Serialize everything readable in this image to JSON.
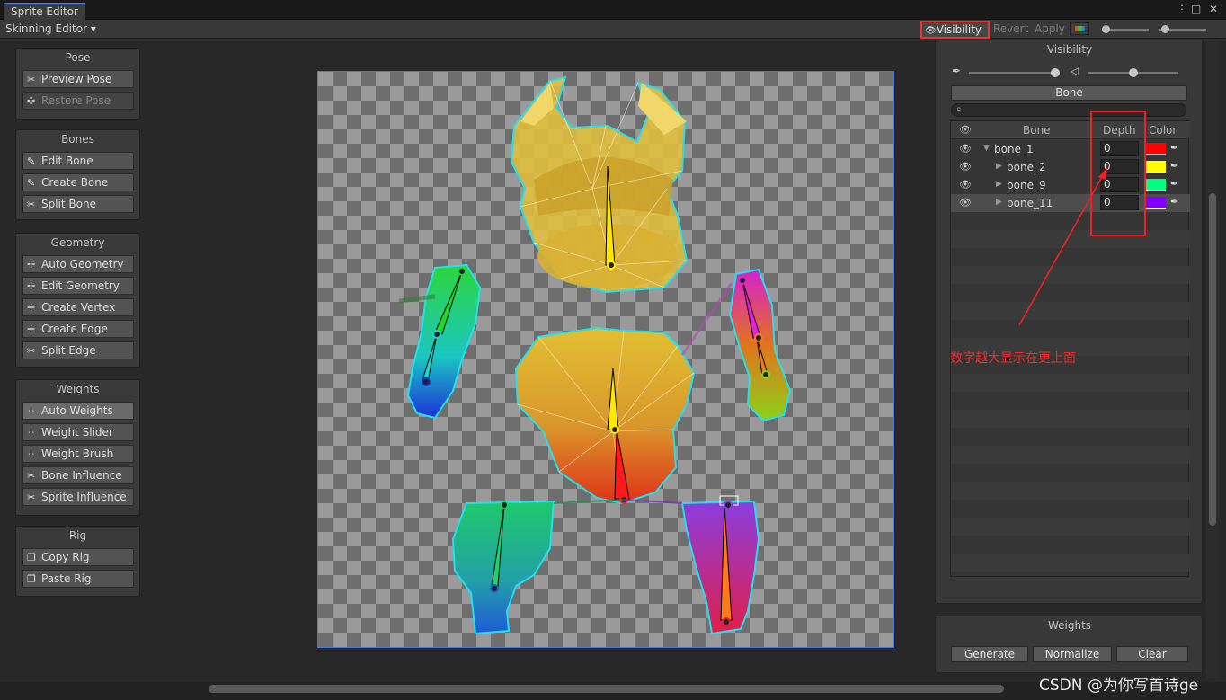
{
  "window": {
    "tab_title": "Sprite Editor",
    "menu_icon": "⋮",
    "maximize_icon": "□",
    "close_icon": "✕"
  },
  "toolbar": {
    "mode_label": "Skinning Editor",
    "mode_caret": "▾",
    "visibility_label": "Visibility",
    "revert_label": "Revert",
    "apply_label": "Apply"
  },
  "tool_panels": {
    "pose": {
      "title": "Pose",
      "items": [
        {
          "label": "Preview Pose",
          "icon": "✂"
        },
        {
          "label": "Restore Pose",
          "icon": "✣"
        }
      ]
    },
    "bones": {
      "title": "Bones",
      "items": [
        {
          "label": "Edit Bone",
          "icon": "✎"
        },
        {
          "label": "Create Bone",
          "icon": "✎"
        },
        {
          "label": "Split Bone",
          "icon": "✂"
        }
      ]
    },
    "geometry": {
      "title": "Geometry",
      "items": [
        {
          "label": "Auto Geometry",
          "icon": "✢"
        },
        {
          "label": "Edit Geometry",
          "icon": "✢"
        },
        {
          "label": "Create Vertex",
          "icon": "✛"
        },
        {
          "label": "Create Edge",
          "icon": "✛"
        },
        {
          "label": "Split Edge",
          "icon": "✂"
        }
      ]
    },
    "weights": {
      "title": "Weights",
      "items": [
        {
          "label": "Auto Weights",
          "icon": "⁘"
        },
        {
          "label": "Weight Slider",
          "icon": "⁘"
        },
        {
          "label": "Weight Brush",
          "icon": "⁘"
        },
        {
          "label": "Bone Influence",
          "icon": "✂"
        },
        {
          "label": "Sprite Influence",
          "icon": "✂"
        }
      ]
    },
    "rig": {
      "title": "Rig",
      "items": [
        {
          "label": "Copy Rig",
          "icon": "❐"
        },
        {
          "label": "Paste Rig",
          "icon": "❐"
        }
      ]
    }
  },
  "visibility_panel": {
    "title": "Visibility",
    "bone_tab_label": "Bone",
    "search_icon": "⌕",
    "columns": {
      "bone": "Bone",
      "depth": "Depth",
      "color": "Color"
    },
    "eye_icon": "👁",
    "expand_icon": "▶",
    "collapse_icon": "▼",
    "picker_icon": "✒",
    "bones": [
      {
        "name": "bone_1",
        "depth": "0",
        "color": "#ff0000"
      },
      {
        "name": "bone_2",
        "depth": "0",
        "color": "#ffff00"
      },
      {
        "name": "bone_9",
        "depth": "0",
        "color": "#00ff80"
      },
      {
        "name": "bone_11",
        "depth": "0",
        "color": "#8000ff"
      }
    ]
  },
  "weights_panel": {
    "title": "Weights",
    "generate_label": "Generate",
    "normalize_label": "Normalize",
    "clear_label": "Clear"
  },
  "annotation": {
    "text": "数字越大显示在更上面"
  },
  "watermark": {
    "text": "CSDN @为你写首诗ge"
  }
}
